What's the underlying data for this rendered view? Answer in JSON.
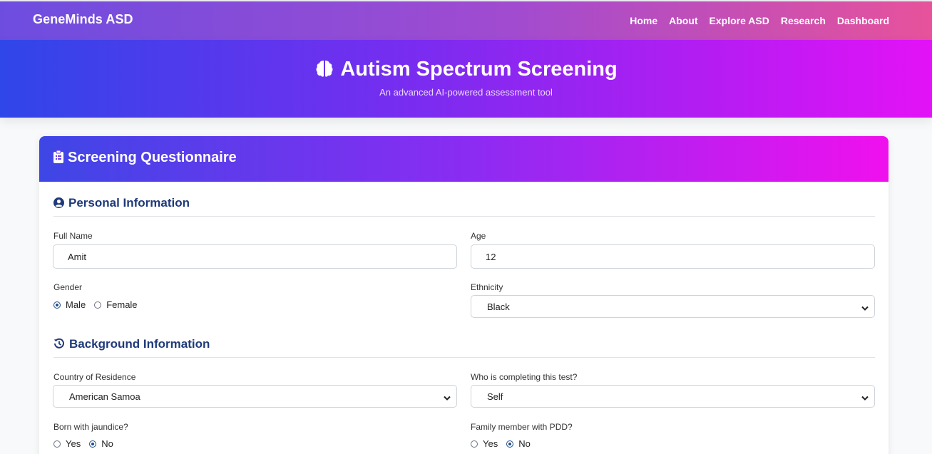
{
  "nav": {
    "brand": "GeneMinds ASD",
    "links": [
      "Home",
      "About",
      "Explore ASD",
      "Research",
      "Dashboard"
    ]
  },
  "hero": {
    "title": "Autism Spectrum Screening",
    "subtitle": "An advanced AI-powered assessment tool",
    "icon": "brain-icon"
  },
  "card": {
    "title": "Screening Questionnaire",
    "icon": "clipboard-icon"
  },
  "personal": {
    "title": "Personal Information",
    "icon": "user-circle-icon",
    "full_name_label": "Full Name",
    "full_name_value": "Amit",
    "age_label": "Age",
    "age_value": "12",
    "gender_label": "Gender",
    "gender_options": [
      "Male",
      "Female"
    ],
    "gender_selected": "Male",
    "ethnicity_label": "Ethnicity",
    "ethnicity_value": "Black"
  },
  "background": {
    "title": "Background Information",
    "icon": "history-icon",
    "country_label": "Country of Residence",
    "country_value": "American Samoa",
    "completer_label": "Who is completing this test?",
    "completer_value": "Self",
    "jaundice_label": "Born with jaundice?",
    "jaundice_options": [
      "Yes",
      "No"
    ],
    "jaundice_selected": "No",
    "family_label": "Family member with PDD?",
    "family_options": [
      "Yes",
      "No"
    ],
    "family_selected": "No"
  },
  "colors": {
    "accent": "#1f3a7a",
    "radio": "#1f4e8c"
  }
}
